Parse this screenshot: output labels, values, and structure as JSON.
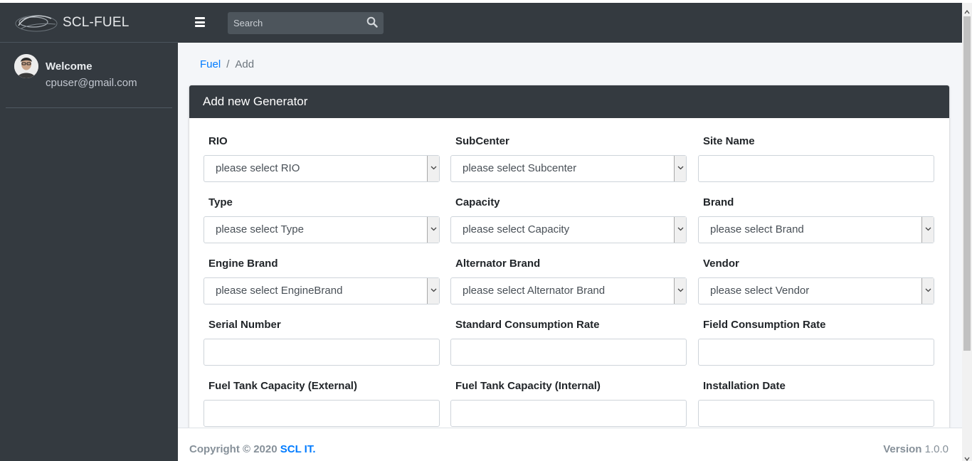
{
  "brand": {
    "name": "SCL-FUEL"
  },
  "user": {
    "welcome": "Welcome",
    "email": "cpuser@gmail.com"
  },
  "navbar": {
    "search_placeholder": "Search"
  },
  "breadcrumb": {
    "parent": "Fuel",
    "current": "Add"
  },
  "card": {
    "title": "Add new Generator"
  },
  "form": {
    "rio": {
      "label": "RIO",
      "value": "please select RIO"
    },
    "subcenter": {
      "label": "SubCenter",
      "value": "please select Subcenter"
    },
    "site_name": {
      "label": "Site Name",
      "value": ""
    },
    "type": {
      "label": "Type",
      "value": "please select Type"
    },
    "capacity": {
      "label": "Capacity",
      "value": "please select Capacity"
    },
    "brand": {
      "label": "Brand",
      "value": "please select Brand"
    },
    "engine_brand": {
      "label": "Engine Brand",
      "value": "please select EngineBrand"
    },
    "alternator_brand": {
      "label": "Alternator Brand",
      "value": "please select Alternator Brand"
    },
    "vendor": {
      "label": "Vendor",
      "value": "please select Vendor"
    },
    "serial_number": {
      "label": "Serial Number",
      "value": ""
    },
    "standard_consumption_rate": {
      "label": "Standard Consumption Rate",
      "value": ""
    },
    "field_consumption_rate": {
      "label": "Field Consumption Rate",
      "value": ""
    },
    "fuel_tank_external": {
      "label": "Fuel Tank Capacity (External)",
      "value": ""
    },
    "fuel_tank_internal": {
      "label": "Fuel Tank Capacity (Internal)",
      "value": ""
    },
    "installation_date": {
      "label": "Installation Date",
      "value": ""
    }
  },
  "footer": {
    "copyright": "Copyright © 2020",
    "company": "SCL IT.",
    "version_label": "Version",
    "version_number": "1.0.0"
  },
  "colors": {
    "sidebar_bg": "#343a40",
    "content_bg": "#f4f6f9",
    "link": "#007bff"
  }
}
